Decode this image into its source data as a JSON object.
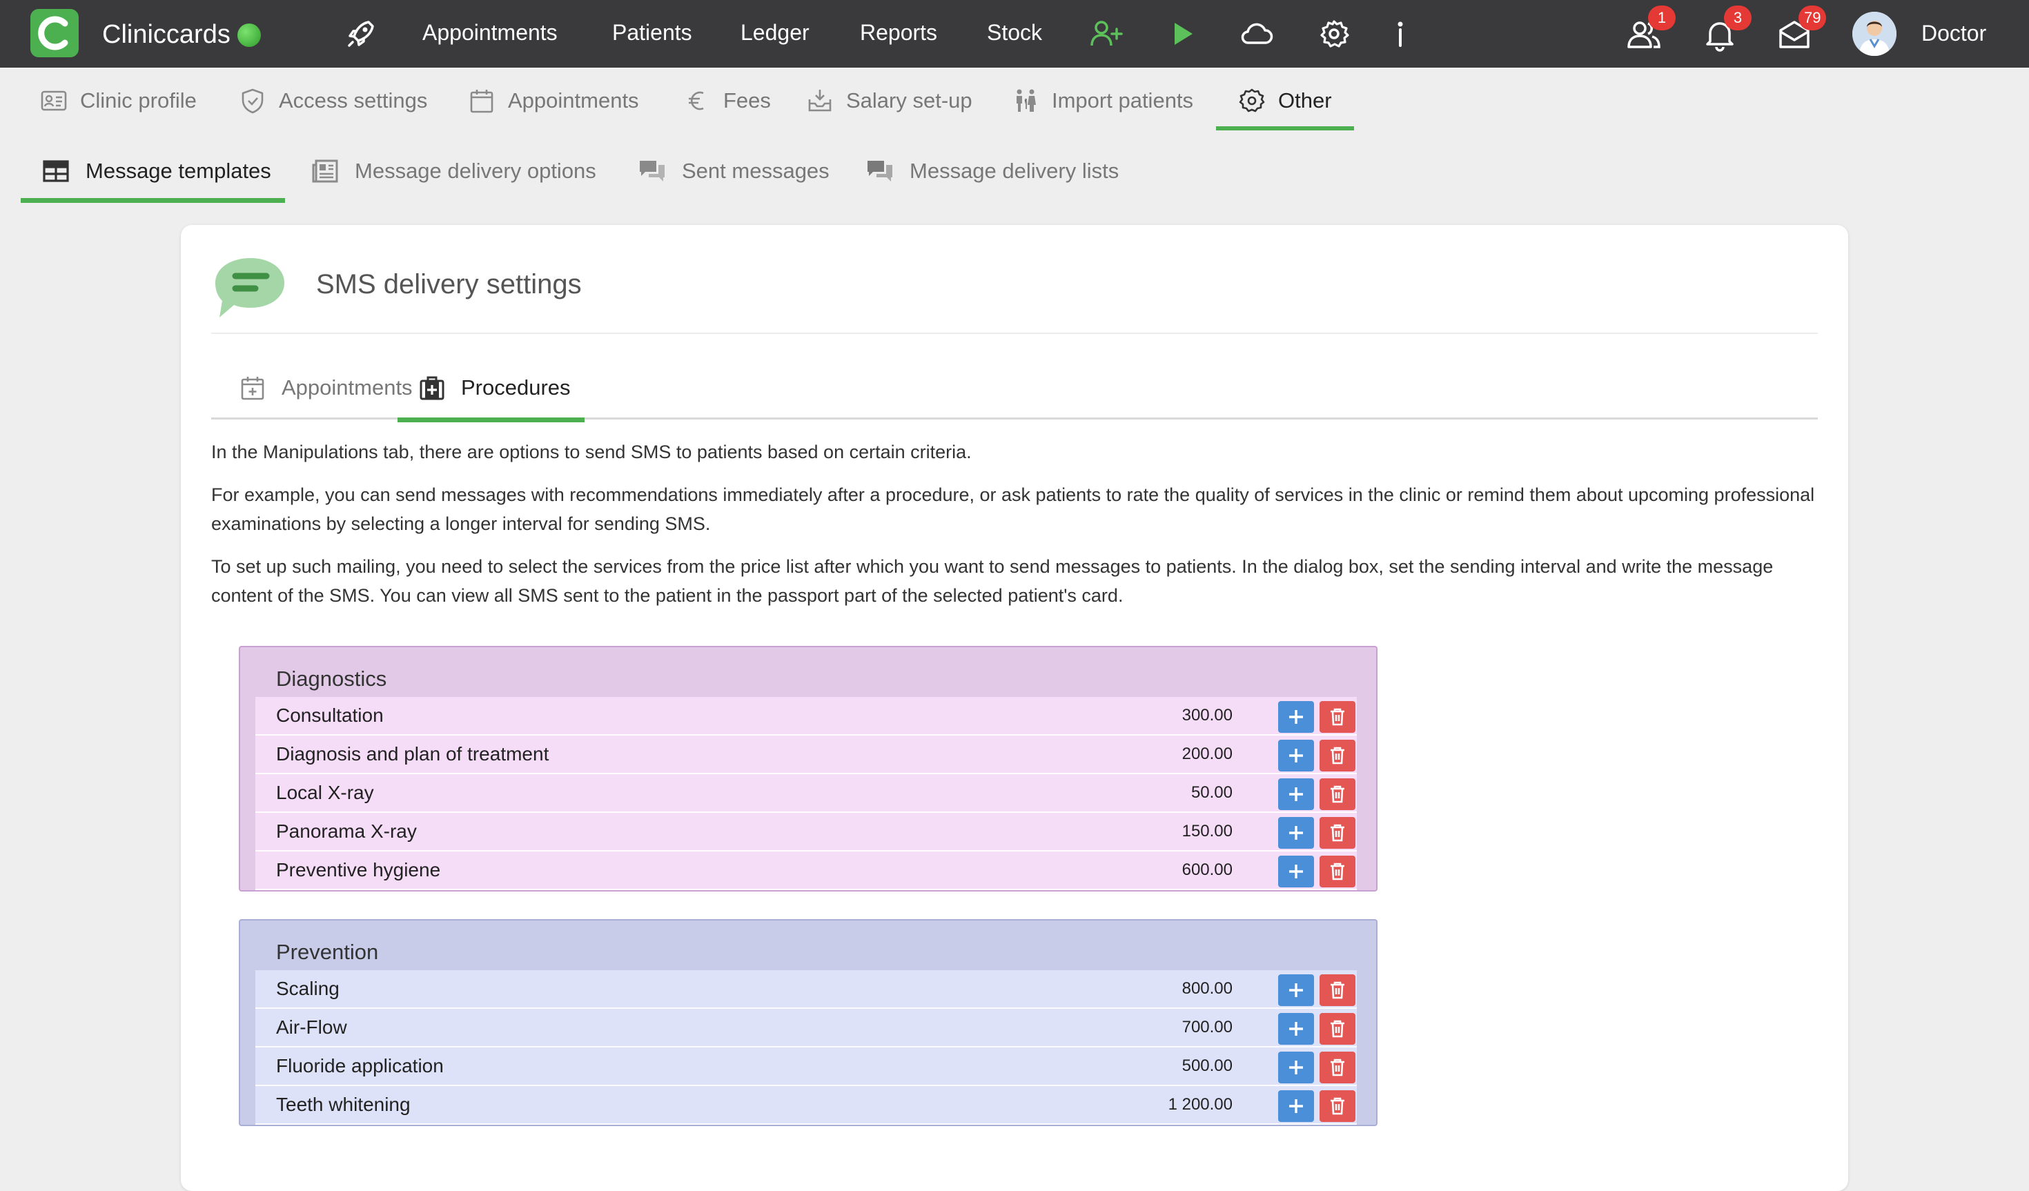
{
  "app": {
    "name": "Cliniccards",
    "user": "Doctor"
  },
  "topnav": {
    "links": [
      "Appointments",
      "Patients",
      "Ledger",
      "Reports",
      "Stock"
    ],
    "badges": {
      "users": "1",
      "notifications": "3",
      "messages": "79"
    }
  },
  "settings_tabs": [
    "Clinic profile",
    "Access settings",
    "Appointments",
    "Fees",
    "Salary set-up",
    "Import patients",
    "Other"
  ],
  "other_tabs": [
    "Message templates",
    "Message delivery options",
    "Sent messages",
    "Message delivery lists"
  ],
  "card": {
    "title": "SMS delivery settings",
    "subtabs": [
      "Appointments",
      "Procedures"
    ],
    "paragraphs": [
      "In the Manipulations tab, there are options to send SMS to patients based on certain criteria.",
      "For example, you can send messages with recommendations immediately after a procedure, or ask patients to rate the quality of services in the clinic or remind them about upcoming professional examinations by selecting a longer interval for sending SMS.",
      "To set up such mailing, you need to select the services from the price list after which you want to send messages to patients. In the dialog box, set the sending interval and write the message content of the SMS. You can view all SMS sent to the patient in the passport part of the selected patient's card."
    ]
  },
  "groups": [
    {
      "title": "Diagnostics",
      "color": "#e3c9e8",
      "row_color": "#f5dcf7",
      "border": "#c8a1d2",
      "items": [
        {
          "name": "Consultation",
          "price": "300.00"
        },
        {
          "name": "Diagnosis and plan of treatment",
          "price": "200.00"
        },
        {
          "name": "Local X-ray",
          "price": "50.00"
        },
        {
          "name": "Panorama X-ray",
          "price": "150.00"
        },
        {
          "name": "Preventive hygiene",
          "price": "600.00"
        }
      ]
    },
    {
      "title": "Prevention",
      "color": "#c8cce8",
      "row_color": "#dee2f8",
      "border": "#a9aed6",
      "items": [
        {
          "name": "Scaling",
          "price": "800.00"
        },
        {
          "name": "Air-Flow",
          "price": "700.00"
        },
        {
          "name": "Fluoride application",
          "price": "500.00"
        },
        {
          "name": "Teeth whitening",
          "price": "1 200.00"
        }
      ]
    }
  ]
}
